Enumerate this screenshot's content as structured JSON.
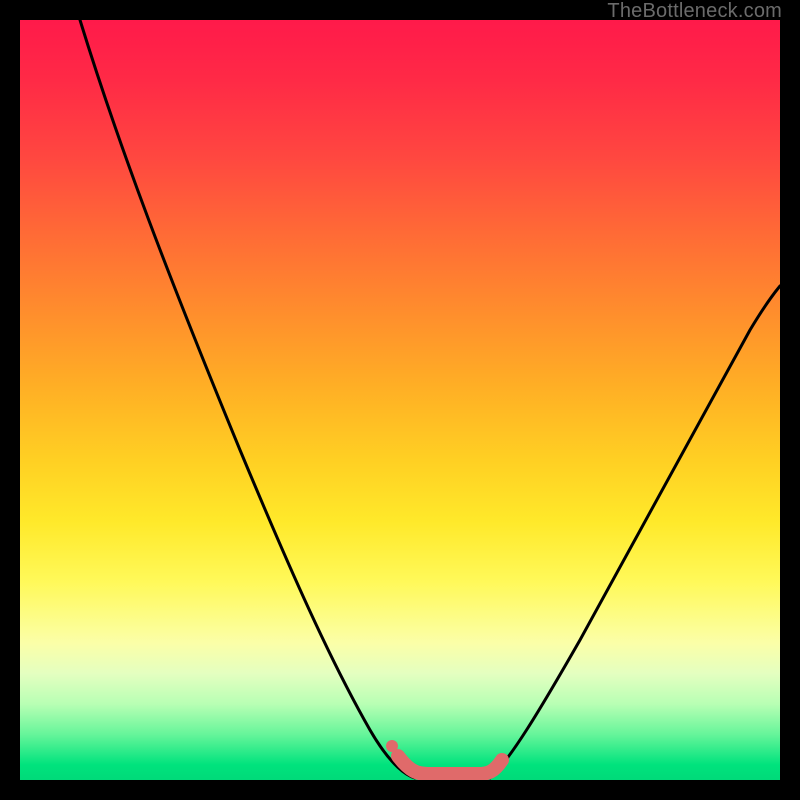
{
  "watermark": {
    "text": "TheBottleneck.com"
  },
  "chart_data": {
    "type": "line",
    "title": "",
    "xlabel": "",
    "ylabel": "",
    "x_range": [
      0,
      760
    ],
    "y_range_pct": [
      0,
      100
    ],
    "background_gradient_stops": [
      {
        "pct": 0,
        "color": "#ff1a4a"
      },
      {
        "pct": 50,
        "color": "#ffc523"
      },
      {
        "pct": 80,
        "color": "#fff95a"
      },
      {
        "pct": 100,
        "color": "#00da79"
      }
    ],
    "series": [
      {
        "name": "left-curve",
        "stroke": "#000000",
        "x": [
          60,
          120,
          180,
          240,
          300,
          340,
          380,
          395
        ],
        "y_pct": [
          100,
          86,
          70,
          52,
          30,
          15,
          3,
          0
        ]
      },
      {
        "name": "right-curve",
        "stroke": "#000000",
        "x": [
          470,
          510,
          560,
          620,
          680,
          740,
          760
        ],
        "y_pct": [
          0,
          6,
          16,
          30,
          45,
          60,
          65
        ]
      },
      {
        "name": "valley-accent",
        "stroke": "#e06a6a",
        "x": [
          375,
          395,
          400,
          460,
          468,
          480
        ],
        "y_pct": [
          3,
          0,
          0,
          0,
          0,
          2
        ]
      },
      {
        "name": "valley-dot",
        "type": "point",
        "stroke": "#e06a6a",
        "x": [
          372
        ],
        "y_pct": [
          4
        ]
      }
    ],
    "legend": []
  }
}
